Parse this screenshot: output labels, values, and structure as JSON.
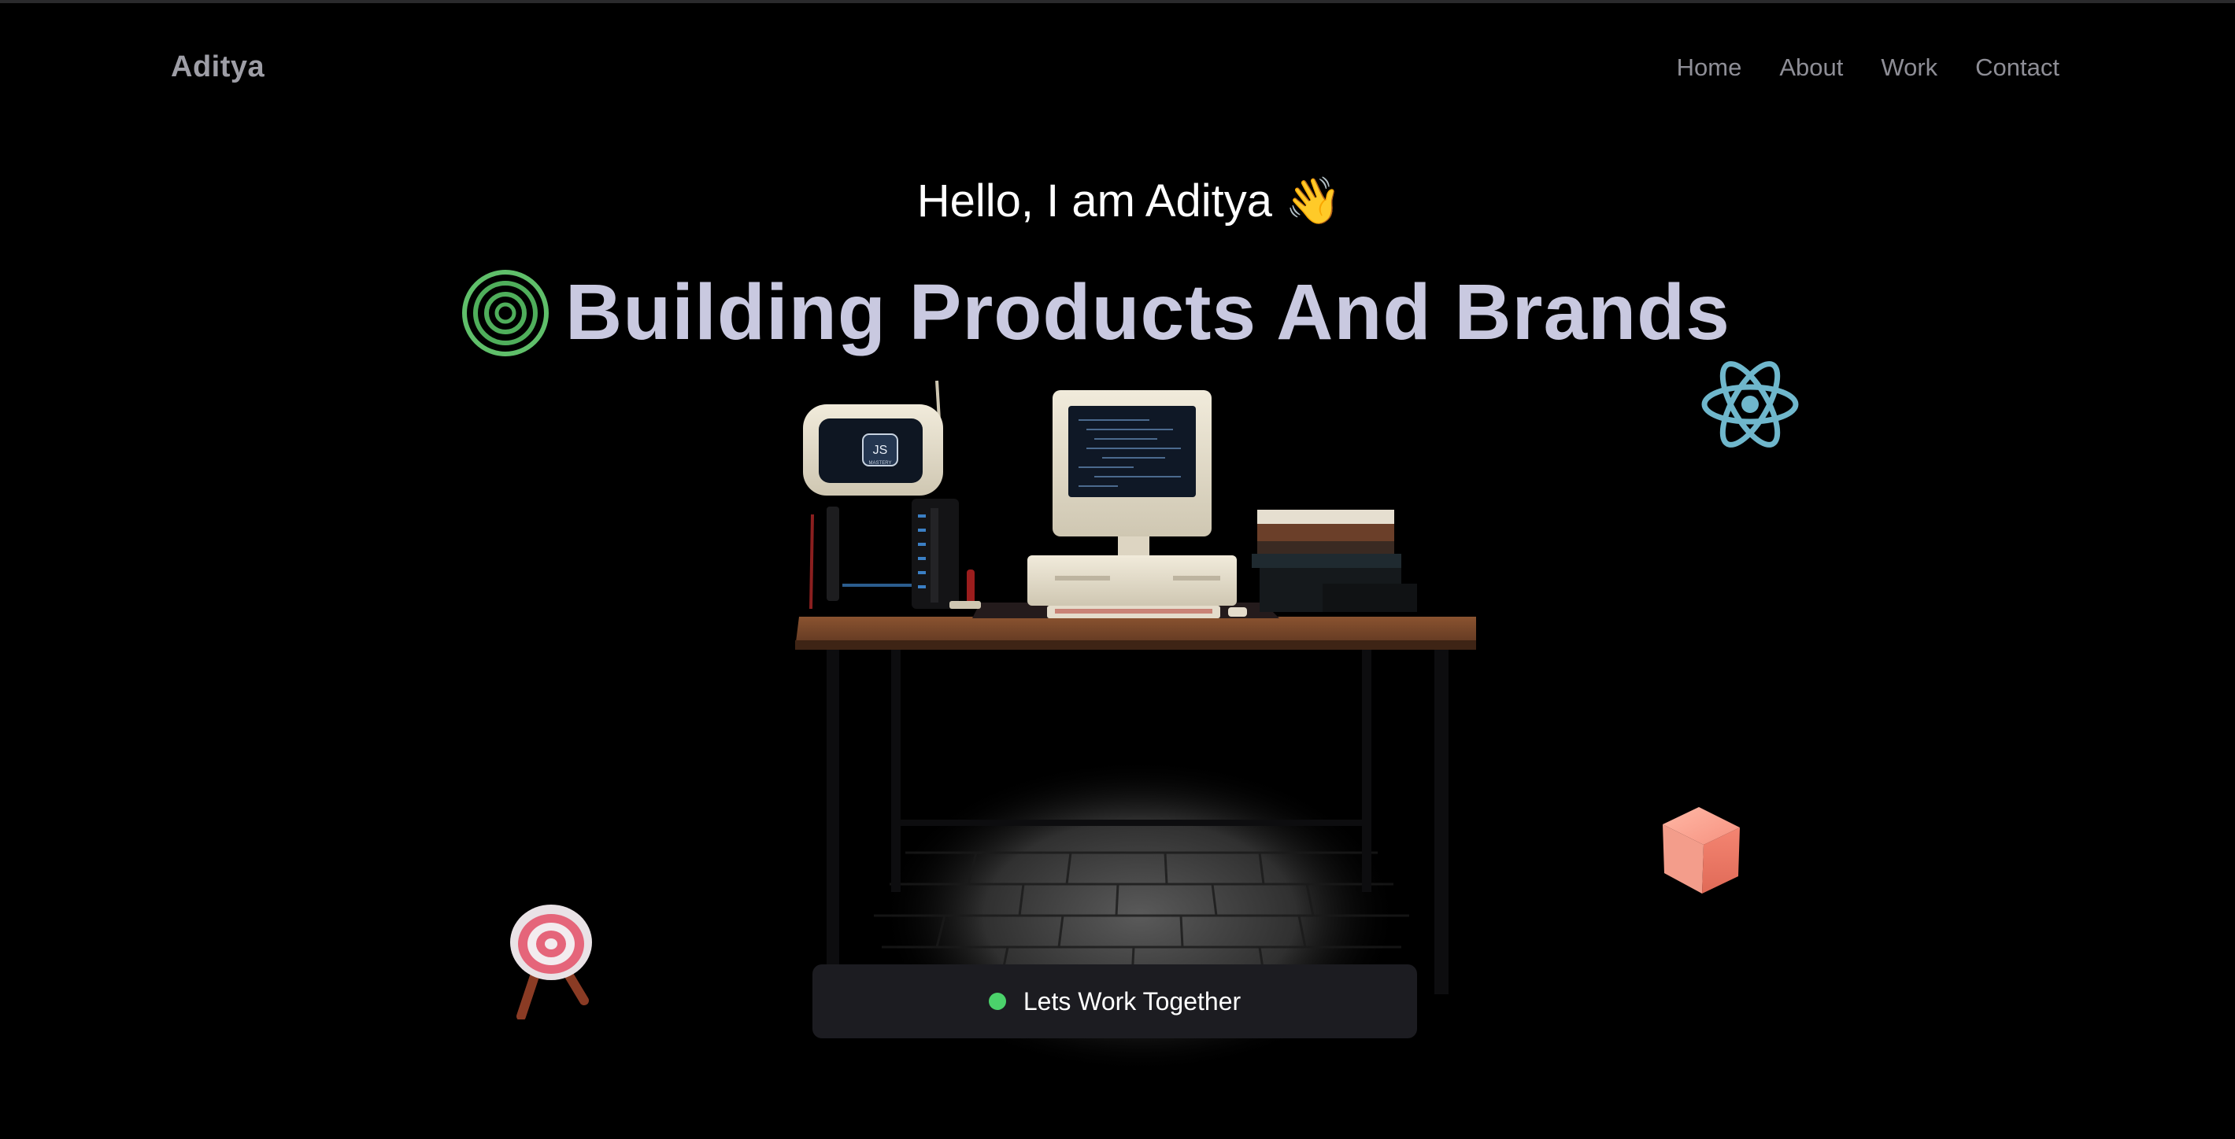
{
  "header": {
    "brand": "Aditya",
    "nav": [
      "Home",
      "About",
      "Work",
      "Contact"
    ]
  },
  "hero": {
    "greeting": "Hello, I am Aditya",
    "greeting_emoji": "👋",
    "headline": "Building Products And Brands"
  },
  "cta": {
    "label": "Lets Work Together",
    "status_color": "#4bd26b"
  },
  "scene": {
    "tv_screen_text": "JS",
    "tv_screen_subtext": "MASTERY"
  },
  "icons": [
    "rings-icon",
    "react-logo-icon",
    "cube-icon",
    "target-icon",
    "wave-hand-icon"
  ],
  "colors": {
    "background": "#000000",
    "headline": "#c9c9e0",
    "nav": "#8e8e96",
    "cta_bg": "#1c1c21"
  }
}
